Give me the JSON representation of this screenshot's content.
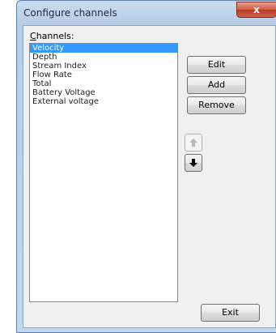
{
  "window": {
    "title": "Configure channels",
    "close_label": "x"
  },
  "channels": {
    "label_mnemonic": "C",
    "label_rest": "hannels:",
    "items": [
      {
        "label": "Velocity",
        "selected": true
      },
      {
        "label": "Depth",
        "selected": false
      },
      {
        "label": "Stream Index",
        "selected": false
      },
      {
        "label": "Flow Rate",
        "selected": false
      },
      {
        "label": "Total",
        "selected": false
      },
      {
        "label": "Battery Voltage",
        "selected": false
      },
      {
        "label": "External voltage",
        "selected": false
      }
    ]
  },
  "buttons": {
    "edit": "Edit",
    "add": "Add",
    "remove": "Remove",
    "exit": "Exit"
  },
  "arrows": {
    "up": {
      "icon": "arrow-up-icon",
      "enabled": false
    },
    "down": {
      "icon": "arrow-down-icon",
      "enabled": true
    }
  },
  "colors": {
    "selection": "#3399ff",
    "titlebar": "#b7cde6"
  }
}
